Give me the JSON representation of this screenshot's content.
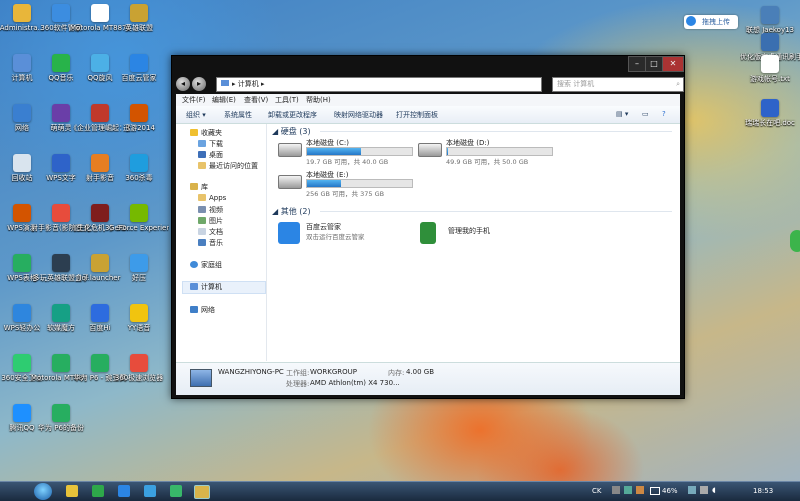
{
  "desktop_icons_left": [
    {
      "label": "Administra...",
      "color": "#e8b63a"
    },
    {
      "label": "360软件管家",
      "color": "#3c8de0"
    },
    {
      "label": "Motorola MT887的...",
      "color": "#ffffff"
    },
    {
      "label": "英雄联盟",
      "color": "#c9a233"
    },
    {
      "label": "计算机",
      "color": "#5a8fd8"
    },
    {
      "label": "QQ音乐",
      "color": "#28b34a"
    },
    {
      "label": "QQ旋风",
      "color": "#4cb0e6"
    },
    {
      "label": "百度云管家",
      "color": "#2b85e4"
    },
    {
      "label": "网络",
      "color": "#3a7fd0"
    },
    {
      "label": "萌萌灵",
      "color": "#6a3ea8"
    },
    {
      "label": "《企业管理崛起：党...",
      "color": "#c0392b"
    },
    {
      "label": "迅游2014",
      "color": "#d35400"
    },
    {
      "label": "回收站",
      "color": "#d9e4ee"
    },
    {
      "label": "WPS文字",
      "color": "#2e63c9"
    },
    {
      "label": "射手影音",
      "color": "#e67e22"
    },
    {
      "label": "360杀毒",
      "color": "#1f9dde"
    },
    {
      "label": "WPS演示",
      "color": "#d35400"
    },
    {
      "label": "射手影音(影院模式)",
      "color": "#e74c3c"
    },
    {
      "label": "《生化危机3》3D...",
      "color": "#7f1d1d"
    },
    {
      "label": "GeForce Experience",
      "color": "#76b900"
    },
    {
      "label": "WPS表格",
      "color": "#27ae60"
    },
    {
      "label": "多玩英雄联盟盒子",
      "color": "#2c3e50"
    },
    {
      "label": "lol.launcher",
      "color": "#c9a233"
    },
    {
      "label": "好压",
      "color": "#3d9be9"
    },
    {
      "label": "WPS轻办公",
      "color": "#2e86de"
    },
    {
      "label": "软媒魔方",
      "color": "#16a085"
    },
    {
      "label": "百度Hi",
      "color": "#2d6cdf"
    },
    {
      "label": "YY语音",
      "color": "#f1c40f"
    },
    {
      "label": "360安全卫士",
      "color": "#2ecc71"
    },
    {
      "label": "Motorola MT887 - 豌...",
      "color": "#27ae60"
    },
    {
      "label": "华为 P6 - 豌豆荚",
      "color": "#27ae60"
    },
    {
      "label": "360极速浏览器",
      "color": "#e74c3c"
    },
    {
      "label": "腾讯QQ",
      "color": "#1e90ff"
    },
    {
      "label": "华为 P6的备份",
      "color": "#27ae60"
    }
  ],
  "desktop_icons_right": [
    {
      "label": "联想 Jaekoy13",
      "color": "#4a7fb8"
    },
    {
      "label": "优化版安卓通讯刷手机",
      "color": "#3a6fb0"
    },
    {
      "label": "游戏帐号.txt",
      "color": "#ffffff"
    },
    {
      "label": "瑞瑞长在吧.doc",
      "color": "#2e63c9"
    }
  ],
  "float_pill": {
    "label": "拖拽上传"
  },
  "window": {
    "address": "▸ 计算机 ▸",
    "search_placeholder": "搜索 计算机",
    "menu": [
      "文件(F)",
      "编辑(E)",
      "查看(V)",
      "工具(T)",
      "帮助(H)"
    ],
    "toolbar": [
      "组织 ▾",
      "系统属性",
      "卸载或更改程序",
      "映射网络驱动器",
      "打开控制面板"
    ],
    "nav": {
      "favorites": "收藏夹",
      "download": "下载",
      "desktop": "桌面",
      "recent": "最近访问的位置",
      "library": "库",
      "apps": "Apps",
      "video": "视频",
      "pictures": "图片",
      "documents": "文档",
      "music": "音乐",
      "homegroup": "家庭组",
      "computer": "计算机",
      "network": "网络"
    },
    "groups": {
      "drives_head": "硬盘 (3)",
      "other_head": "其他 (2)"
    },
    "drives": [
      {
        "name": "本地磁盘 (C:)",
        "info": "19.7 GB 可用，共 40.0 GB",
        "used_fraction": 0.51
      },
      {
        "name": "本地磁盘 (D:)",
        "info": "49.9 GB 可用，共 50.0 GB",
        "used_fraction": 0.01
      },
      {
        "name": "本地磁盘 (E:)",
        "info": "256 GB 可用，共 375 GB",
        "used_fraction": 0.32
      }
    ],
    "other": [
      {
        "name": "百度云管家",
        "sub": "双击运行百度云管家"
      },
      {
        "name": "管理我的手机",
        "sub": ""
      }
    ],
    "details": {
      "pc_name": "WANGZHIYONG-PC",
      "workgroup_label": "工作组:",
      "workgroup": "WORKGROUP",
      "memory_label": "内存:",
      "memory": "4.00 GB",
      "cpu_label": "处理器:",
      "cpu": "AMD Athlon(tm) X4 730..."
    }
  },
  "taskbar": {
    "battery": "46%",
    "clock": "18:53",
    "ime": "CK"
  }
}
